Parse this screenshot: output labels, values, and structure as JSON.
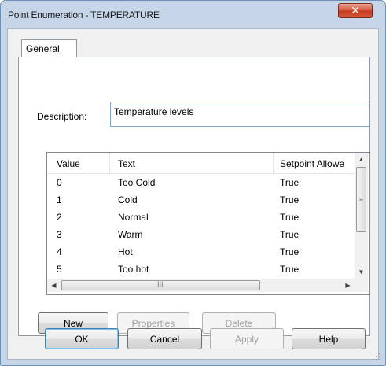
{
  "window": {
    "title": "Point Enumeration - TEMPERATURE",
    "close_glyph": "✕"
  },
  "tabs": [
    {
      "label": "General",
      "selected": true
    }
  ],
  "description": {
    "label": "Description:",
    "value": "Temperature levels"
  },
  "table": {
    "columns": [
      "Value",
      "Text",
      "Setpoint Allowe"
    ],
    "rows": [
      {
        "value": "0",
        "text": "Too Cold",
        "setpoint": "True"
      },
      {
        "value": "1",
        "text": "Cold",
        "setpoint": "True"
      },
      {
        "value": "2",
        "text": "Normal",
        "setpoint": "True"
      },
      {
        "value": "3",
        "text": "Warm",
        "setpoint": "True"
      },
      {
        "value": "4",
        "text": "Hot",
        "setpoint": "True"
      },
      {
        "value": "5",
        "text": "Too hot",
        "setpoint": "True"
      }
    ]
  },
  "list_buttons": {
    "new_label": "New",
    "properties_label": "Properties",
    "delete_label": "Delete"
  },
  "dialog_buttons": {
    "ok_label": "OK",
    "cancel_label": "Cancel",
    "apply_label": "Apply",
    "help_label": "Help"
  },
  "icons": {
    "scroll_up": "▲",
    "scroll_down": "▼",
    "scroll_left": "◀",
    "scroll_right": "▶",
    "grip_vertical": "≡",
    "grip_horizontal": "III"
  },
  "colors": {
    "frame": "#c6d5e8",
    "client": "#f0f0f0",
    "close_button": "#c23a1e",
    "input_border": "#7fa6cf"
  }
}
